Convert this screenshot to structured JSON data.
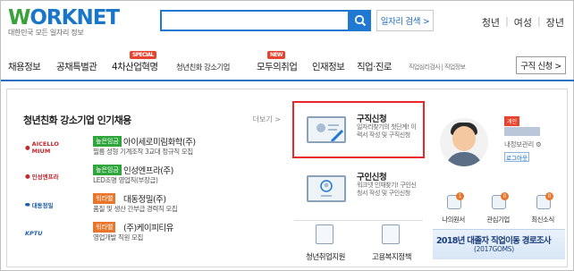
{
  "header": {
    "logo_text_blue": "W",
    "logo_text_rest": "ORKNET",
    "logo_subtitle": "대한민국 모든 일자리 정보",
    "search_placeholder": "",
    "advanced_search": "일자리 검색 >",
    "top_links": [
      "청년",
      "여성",
      "장년"
    ]
  },
  "gnb": {
    "items": [
      "채용정보",
      "공채특별관",
      "4차산업혁명",
      "청년친화 강소기업",
      "모두의취업",
      "인재정보",
      "직업·진로"
    ],
    "badge_special": "SPECIAL",
    "badge_new": "NEW",
    "tiny_links": "직업심리검사 | 직업정보",
    "apply_button": "구직 신청 >"
  },
  "companies_panel": {
    "title": "청년친화 강소기업 인기채용",
    "more": "더보기 >",
    "companies": [
      {
        "logo": "AICELLO MIUM",
        "tag": "높은임금",
        "tag_color": "#2fa63c",
        "name": "아이세로미림화학(주)",
        "desc": "필름 성형 기계조작 3교대 정규직 모집"
      },
      {
        "logo": "인성엔프라",
        "tag": "높은임금",
        "tag_color": "#2fa63c",
        "name": "인성엔프라(주)",
        "desc": "LED조명 영업직(부장급)"
      },
      {
        "logo": "대동정밀",
        "tag": "워라밸",
        "tag_color": "#e9762a",
        "name": "대동정밀(주)",
        "desc": "품질 및 생산 간부급 경력직 모집"
      },
      {
        "logo": "KPTU",
        "tag": "워라밸",
        "tag_color": "#e9762a",
        "name": "(주)케이피티유",
        "desc": "영업개발 직원 모집"
      }
    ]
  },
  "service": {
    "apply": {
      "title": "구직신청",
      "desc": "일자리찾기의 첫단계! 이력서 작성 및 구직신청"
    },
    "hire": {
      "title": "구인신청",
      "desc": "워크넷 인재찾기! 구인신청서 작성 및 구인신청"
    },
    "youth_support": "청년취업지원",
    "employment_policy": "고용복지정책"
  },
  "profile": {
    "badge": "개인",
    "info_link": "내정보관리 ⚙",
    "logout": "로그아웃",
    "quick": [
      {
        "label": "나의원서",
        "count": "1"
      },
      {
        "label": "관심기업",
        "count": "0"
      },
      {
        "label": "최신소식",
        "count": "0"
      }
    ],
    "banner_title": "2018년 대졸자 직업이동 경로조사",
    "banner_sub": "(2017GOMS)"
  },
  "colors": {
    "brand_blue": "#1f78d1",
    "highlight_red": "#e6282b",
    "green_tag": "#2fa63c",
    "orange_tag": "#e9762a"
  }
}
